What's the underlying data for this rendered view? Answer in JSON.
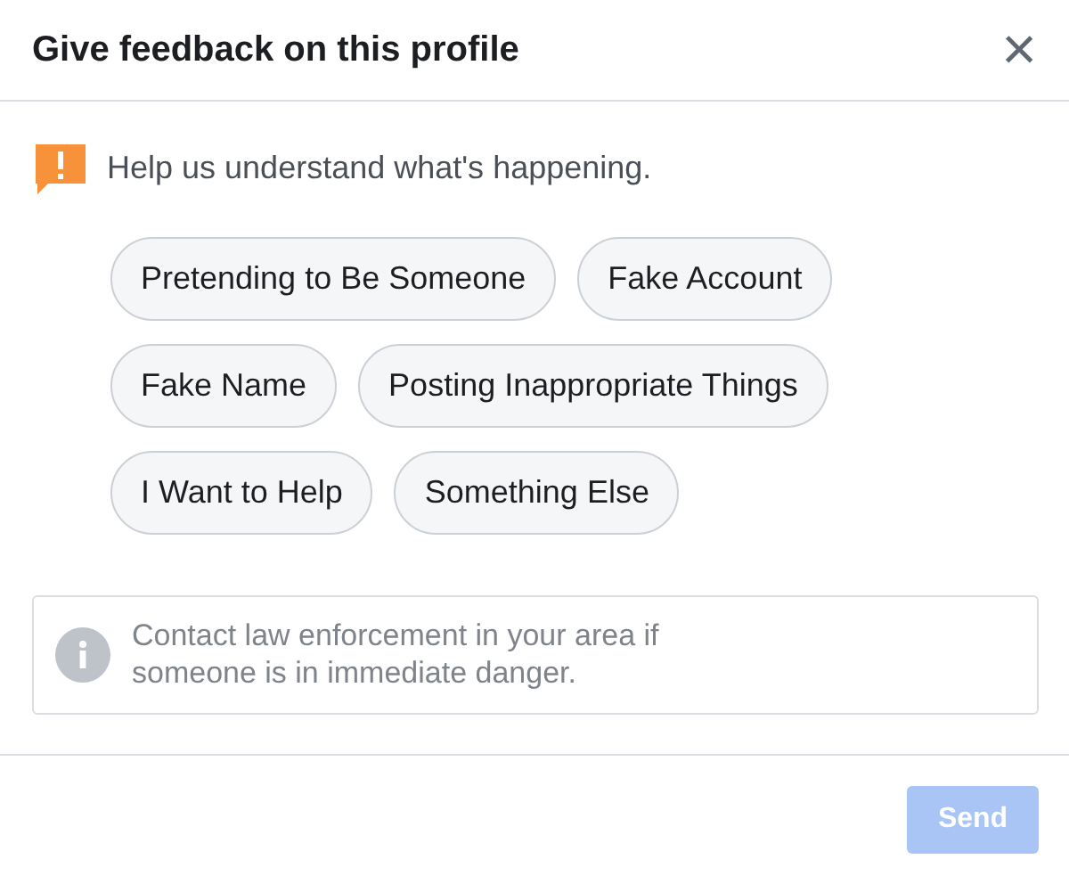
{
  "dialog": {
    "title": "Give feedback on this profile",
    "close": "×"
  },
  "prompt": "Help us understand what's happening.",
  "options": [
    {
      "label": "Pretending to Be Someone",
      "selected": false
    },
    {
      "label": "Fake Account",
      "selected": false
    },
    {
      "label": "Fake Name",
      "selected": false
    },
    {
      "label": "Posting Inappropriate Things",
      "selected": false
    },
    {
      "label": "I Want to Help",
      "selected": false
    },
    {
      "label": "Something Else",
      "selected": false
    }
  ],
  "notice": "Contact law enforcement in your area if someone is in immediate danger.",
  "send_button": {
    "label": "Send",
    "disabled": true
  }
}
